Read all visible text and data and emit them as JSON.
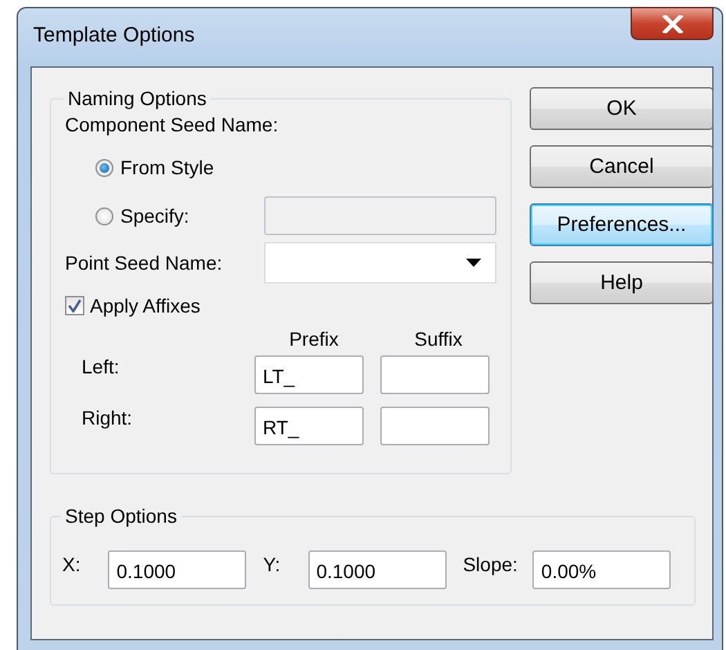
{
  "window": {
    "title": "Template Options"
  },
  "naming_options": {
    "title": "Naming Options",
    "component_seed_label": "Component Seed Name:",
    "radios": [
      {
        "label": "From Style",
        "selected": true
      },
      {
        "label": "Specify:",
        "selected": false
      }
    ],
    "specify_field": {
      "disabled": true
    },
    "point_seed_label": "Point Seed Name:",
    "apply_affixes": {
      "label": "Apply Affixes",
      "checked": true
    },
    "affix_columns": [
      "Prefix",
      "Suffix"
    ],
    "affix_rows": [
      {
        "label": "Left:",
        "prefix": "LT_"
      },
      {
        "label": "Right:",
        "prefix": "RT_"
      }
    ]
  },
  "buttons": [
    {
      "label": "OK",
      "focused": false
    },
    {
      "label": "Cancel",
      "focused": false
    },
    {
      "label": "Preferences...",
      "focused": true
    },
    {
      "label": "Help",
      "focused": false
    }
  ],
  "step_options": {
    "title": "Step Options",
    "fields": [
      {
        "label": "X:",
        "value": "0.1000"
      },
      {
        "label": "Y:",
        "value": "0.1000"
      },
      {
        "label": "Slope:",
        "value": "0.00%"
      }
    ]
  }
}
